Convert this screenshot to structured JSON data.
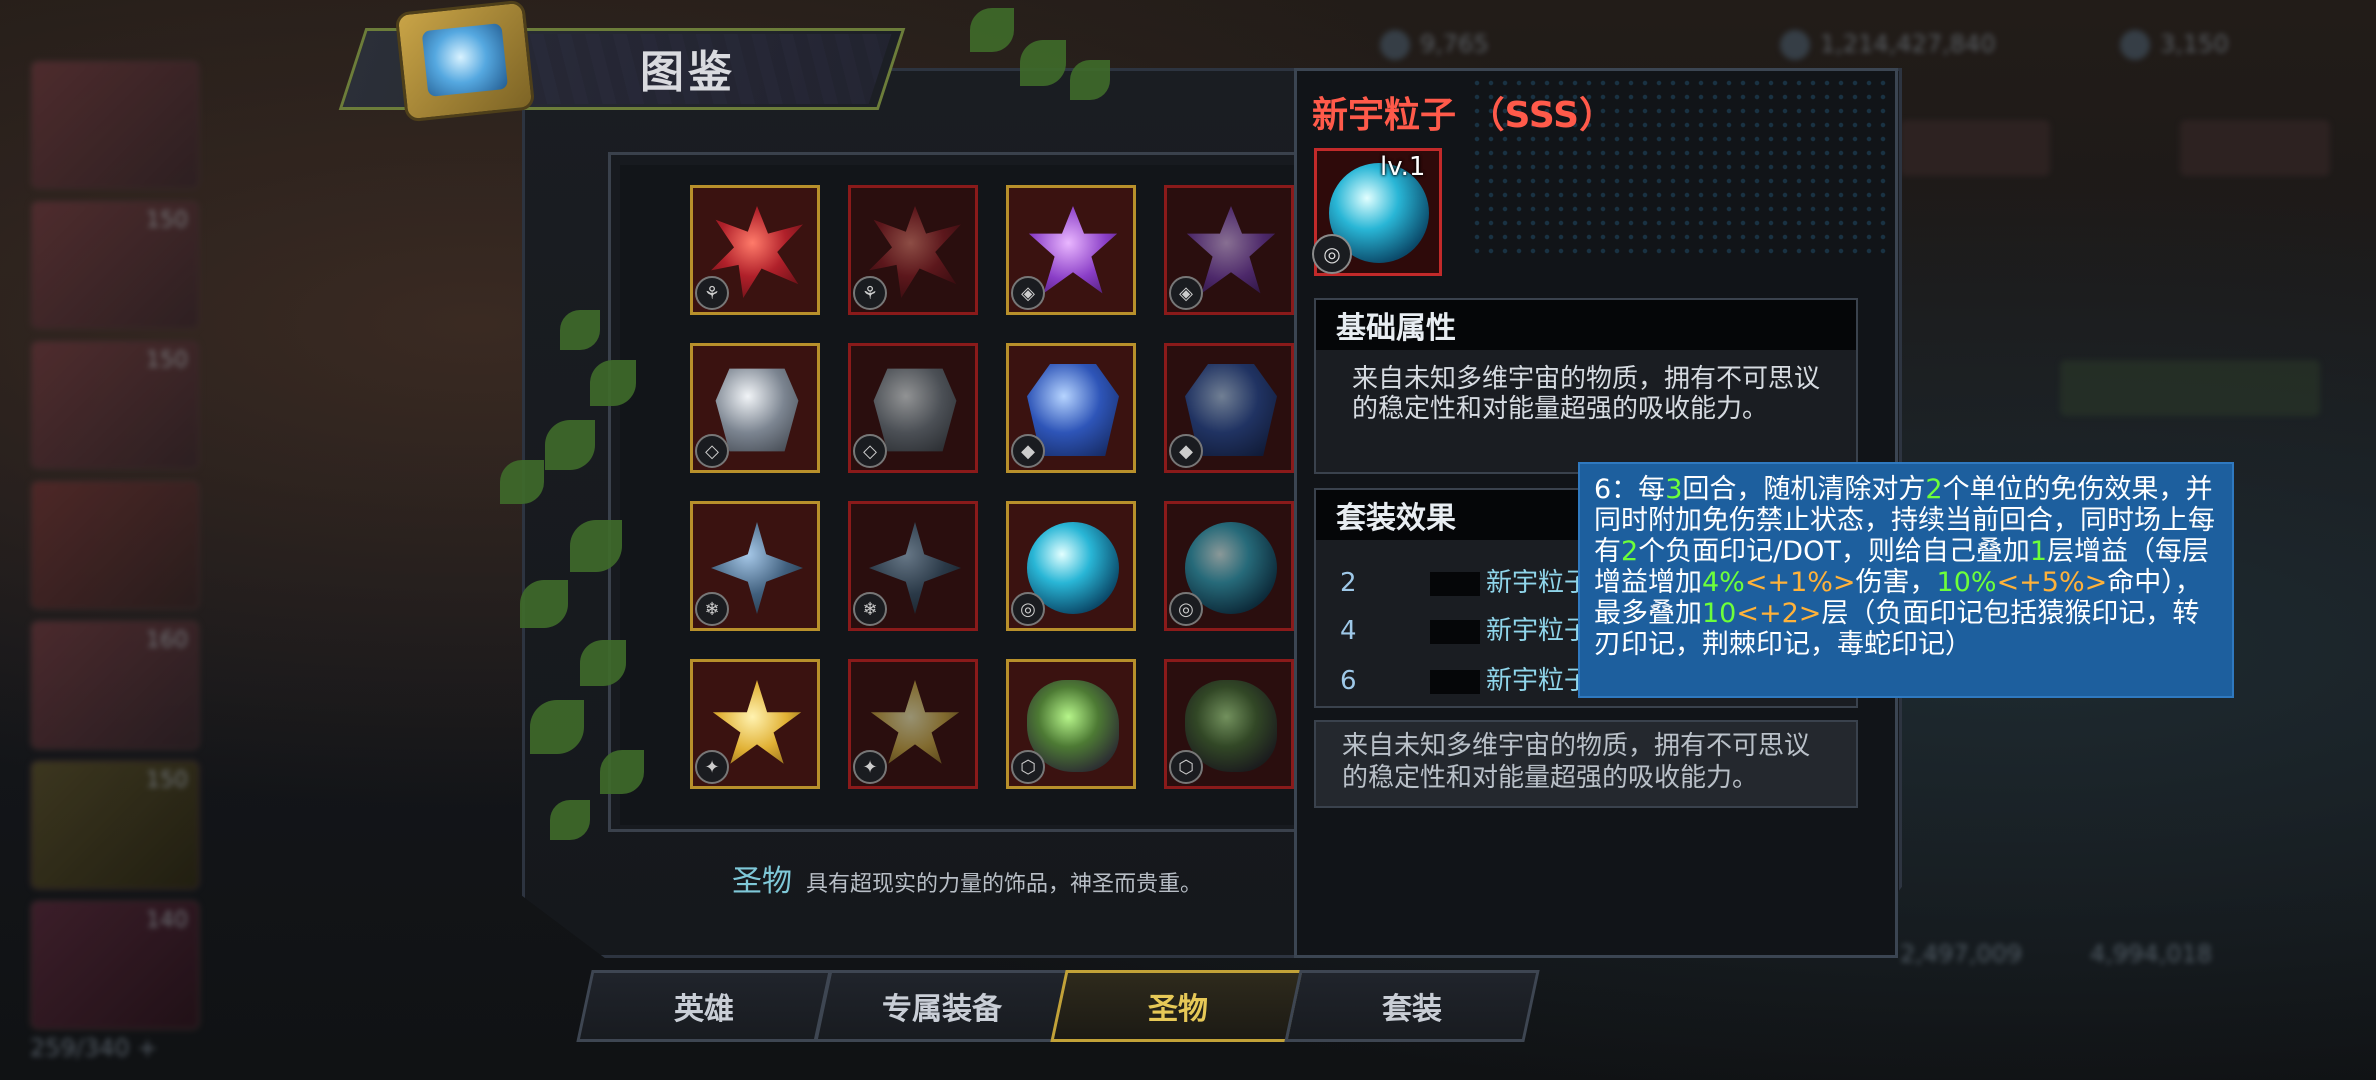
{
  "background": {
    "resources": [
      {
        "icon": "gem-icon",
        "value": "9,765"
      },
      {
        "icon": "coin-icon",
        "value": "1,214,427,840"
      },
      {
        "icon": "crystal-icon",
        "value": "3,150"
      }
    ],
    "card_values": [
      "150",
      "150",
      "150",
      "160",
      "150",
      "140"
    ],
    "bottom_values": [
      "2,497,009",
      "4,994,018"
    ],
    "collection_count": "259/340 +"
  },
  "header": {
    "title": "图鉴",
    "icon": "album-icon"
  },
  "grid": {
    "items": [
      {
        "gem": "red",
        "frame": "gold",
        "badge": "⚘"
      },
      {
        "gem": "red",
        "frame": "red",
        "badge": "⚘"
      },
      {
        "gem": "purple",
        "frame": "gold",
        "badge": "◈"
      },
      {
        "gem": "purple",
        "frame": "red",
        "badge": "◈"
      },
      {
        "gem": "silver",
        "frame": "gold",
        "badge": "◇"
      },
      {
        "gem": "silver",
        "frame": "red",
        "badge": "◇"
      },
      {
        "gem": "blue",
        "frame": "gold",
        "badge": "◆"
      },
      {
        "gem": "blue",
        "frame": "red",
        "badge": "◆"
      },
      {
        "gem": "crystal",
        "frame": "gold",
        "badge": "❄"
      },
      {
        "gem": "crystal",
        "frame": "red",
        "badge": "❄"
      },
      {
        "gem": "cyan",
        "frame": "gold",
        "badge": "◎"
      },
      {
        "gem": "cyan",
        "frame": "red",
        "badge": "◎"
      },
      {
        "gem": "star",
        "frame": "gold",
        "badge": "✦"
      },
      {
        "gem": "star",
        "frame": "red",
        "badge": "✦"
      },
      {
        "gem": "green",
        "frame": "gold",
        "badge": "⬡"
      },
      {
        "gem": "green",
        "frame": "red",
        "badge": "⬡"
      }
    ]
  },
  "category": {
    "name": "圣物",
    "description": "具有超现实的力量的饰品，神圣而贵重。"
  },
  "tabs": [
    {
      "label": "英雄",
      "active": false
    },
    {
      "label": "专属装备",
      "active": false
    },
    {
      "label": "圣物",
      "active": true
    },
    {
      "label": "套装",
      "active": false
    }
  ],
  "detail": {
    "title": "新宇粒子 （SSS）",
    "level": "lv.1",
    "basic_header": "基础属性",
    "basic_text": "来自未知多维宇宙的物质，拥有不可思议的稳定性和对能量超强的吸收能力。",
    "set_header": "套装效果",
    "set_rows": [
      {
        "count": "2",
        "name": "新宇粒子"
      },
      {
        "count": "4",
        "name": "新宇粒子"
      },
      {
        "count": "6",
        "name": "新宇粒子"
      }
    ],
    "description": "来自未知多维宇宙的物质，拥有不可思议的稳定性和对能量超强的吸收能力。"
  },
  "tooltip": {
    "segments": [
      {
        "text": "6：每",
        "style": "normal"
      },
      {
        "text": "3",
        "style": "green"
      },
      {
        "text": "回合，随机清除对方",
        "style": "normal"
      },
      {
        "text": "2",
        "style": "green"
      },
      {
        "text": "个单位的免伤效果，并同时附加免伤禁止状态，持续当前回合，同时场上每有",
        "style": "normal"
      },
      {
        "text": "2",
        "style": "green"
      },
      {
        "text": "个负面印记/DOT，则给自己叠加",
        "style": "normal"
      },
      {
        "text": "1",
        "style": "green"
      },
      {
        "text": "层增益（每层增益增加",
        "style": "normal"
      },
      {
        "text": "4%",
        "style": "green"
      },
      {
        "text": "<+1%>",
        "style": "orange"
      },
      {
        "text": "伤害，",
        "style": "normal"
      },
      {
        "text": "10%",
        "style": "green"
      },
      {
        "text": "<+5%>",
        "style": "orange"
      },
      {
        "text": "命中），最多叠加",
        "style": "normal"
      },
      {
        "text": "10",
        "style": "green"
      },
      {
        "text": "<+2>",
        "style": "orange"
      },
      {
        "text": "层（负面印记包括猿猴印记，转刃印记，荆棘印记，毒蛇印记）",
        "style": "normal"
      }
    ]
  },
  "colors": {
    "accent_gold": "#c2a238",
    "rarity_red": "#ff5a4a",
    "tooltip_bg": "#1d5f9e",
    "highlight_green": "#6dff3a",
    "highlight_orange": "#ffb23a"
  }
}
